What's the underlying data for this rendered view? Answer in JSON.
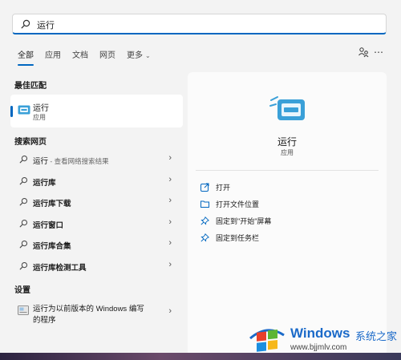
{
  "search": {
    "value": "运行"
  },
  "tabs": [
    {
      "label": "全部",
      "active": true
    },
    {
      "label": "应用"
    },
    {
      "label": "文档"
    },
    {
      "label": "网页"
    },
    {
      "label": "更多"
    }
  ],
  "best_match": {
    "title": "最佳匹配",
    "name": "运行",
    "type": "应用"
  },
  "web_search": {
    "title": "搜索网页",
    "items": [
      {
        "label": "运行",
        "hint": " - 查看网络搜索结果"
      },
      {
        "label": "运行库"
      },
      {
        "label": "运行库下载"
      },
      {
        "label": "运行窗口"
      },
      {
        "label": "运行库合集"
      },
      {
        "label": "运行库检测工具"
      }
    ]
  },
  "settings": {
    "title": "设置",
    "line1": "运行为以前版本的 Windows 编写",
    "line2": "的程序"
  },
  "detail": {
    "name": "运行",
    "type": "应用",
    "actions": [
      {
        "label": "打开",
        "icon": "open-icon"
      },
      {
        "label": "打开文件位置",
        "icon": "folder-icon"
      },
      {
        "label": "固定到\"开始\"屏幕",
        "icon": "pin-icon"
      },
      {
        "label": "固定到任务栏",
        "icon": "pin-icon"
      }
    ]
  },
  "watermark": {
    "brand": "Windows",
    "cn": "系统之家",
    "url": "www.bjjmlv.com"
  },
  "colors": {
    "accent": "#0067c0",
    "run_icon": "#3aa0d8"
  }
}
